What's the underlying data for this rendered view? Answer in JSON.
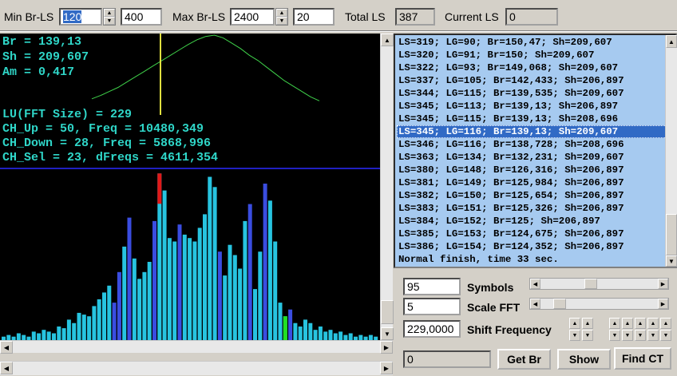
{
  "toolbar": {
    "min_label": "Min Br-LS",
    "min_value": "120",
    "min_value2": "400",
    "max_label": "Max Br-LS",
    "max_value": "2400",
    "max_value2": "20",
    "total_label": "Total LS",
    "total_value": "387",
    "current_label": "Current LS",
    "current_value": "0"
  },
  "display": {
    "br": "Br = 139,13",
    "sh": "Sh = 209,607",
    "am": "Am = 0,417",
    "lu": "LU(FFT Size) = 229",
    "ch_up": "CH_Up = 50, Freq = 10480,349",
    "ch_down": "CH_Down = 28, Freq = 5868,996",
    "ch_sel": "CH_Sel = 23, dFreqs = 4611,354"
  },
  "list": {
    "rows": [
      "LS=319; LG=90; Br=150,47; Sh=209,607",
      "LS=320; LG=91; Br=150; Sh=209,607",
      "LS=322; LG=93; Br=149,068; Sh=209,607",
      "LS=337; LG=105; Br=142,433; Sh=206,897",
      "LS=344; LG=115; Br=139,535; Sh=209,607",
      "LS=345; LG=113; Br=139,13; Sh=206,897",
      "LS=345; LG=115; Br=139,13; Sh=208,696",
      "LS=345; LG=116; Br=139,13; Sh=209,607",
      "LS=346; LG=116; Br=138,728; Sh=208,696",
      "LS=363; LG=134; Br=132,231; Sh=209,607",
      "LS=380; LG=148; Br=126,316; Sh=206,897",
      "LS=381; LG=149; Br=125,984; Sh=206,897",
      "LS=382; LG=150; Br=125,654; Sh=206,897",
      "LS=383; LG=151; Br=125,326; Sh=206,897",
      "LS=384; LG=152; Br=125; Sh=206,897",
      "LS=385; LG=153; Br=124,675; Sh=206,897",
      "LS=386; LG=154; Br=124,352; Sh=206,897",
      "Normal finish, time 33 sec."
    ],
    "selected_index": 7
  },
  "controls": {
    "symbols_value": "95",
    "symbols_label": "Symbols",
    "symbols_level": 0.42,
    "scale_value": "5",
    "scale_label": "Scale FFT",
    "scale_level": 0.12,
    "shift_value": "229,0000",
    "shift_label": "Shift Frequency",
    "status_value": "0",
    "getbr_label": "Get Br",
    "show_label": "Show",
    "findct_label": "Find CT"
  },
  "colors": {
    "display_bg": "#000000",
    "text_cyan": "#2fd6c8",
    "curve_green": "#3fd14a",
    "marker_yellow": "#e0e040",
    "baseline_blue": "#2020c0",
    "bar_cyan": "#27c4e0",
    "bar_blue": "#3a4de0",
    "bar_red": "#e01818",
    "bar_green": "#22e022",
    "selection": "#316ac5",
    "list_bg": "#a6caf0"
  },
  "spectrum": {
    "bars": [
      0.02,
      0.03,
      0.02,
      0.04,
      0.03,
      0.02,
      0.05,
      0.04,
      0.06,
      0.05,
      0.04,
      0.08,
      0.07,
      0.12,
      0.1,
      0.16,
      0.15,
      0.14,
      0.2,
      0.24,
      0.28,
      0.32,
      0.22,
      0.4,
      0.55,
      0.72,
      0.48,
      0.36,
      0.4,
      0.46,
      0.7,
      0.98,
      0.88,
      0.6,
      0.58,
      0.68,
      0.62,
      0.6,
      0.58,
      0.66,
      0.74,
      0.96,
      0.9,
      0.52,
      0.38,
      0.56,
      0.5,
      0.42,
      0.7,
      0.8,
      0.3,
      0.52,
      0.92,
      0.82,
      0.58,
      0.22,
      0.14,
      0.18,
      0.1,
      0.08,
      0.12,
      0.1,
      0.06,
      0.08,
      0.05,
      0.06,
      0.04,
      0.05,
      0.03,
      0.04,
      0.02,
      0.03,
      0.02,
      0.03,
      0.02
    ],
    "red_bar": 31,
    "green_bar": 56,
    "dark_bars": [
      22,
      23,
      25,
      30,
      35,
      43,
      49,
      52,
      57
    ]
  },
  "curve": {
    "points": [
      0.05,
      0.1,
      0.16,
      0.22,
      0.3,
      0.38,
      0.46,
      0.54,
      0.62,
      0.7,
      0.78,
      0.86,
      0.93,
      0.98,
      1.0,
      0.96,
      0.88,
      0.8,
      0.7,
      0.62,
      0.52,
      0.42,
      0.32,
      0.24,
      0.16,
      0.08,
      0.02
    ]
  }
}
